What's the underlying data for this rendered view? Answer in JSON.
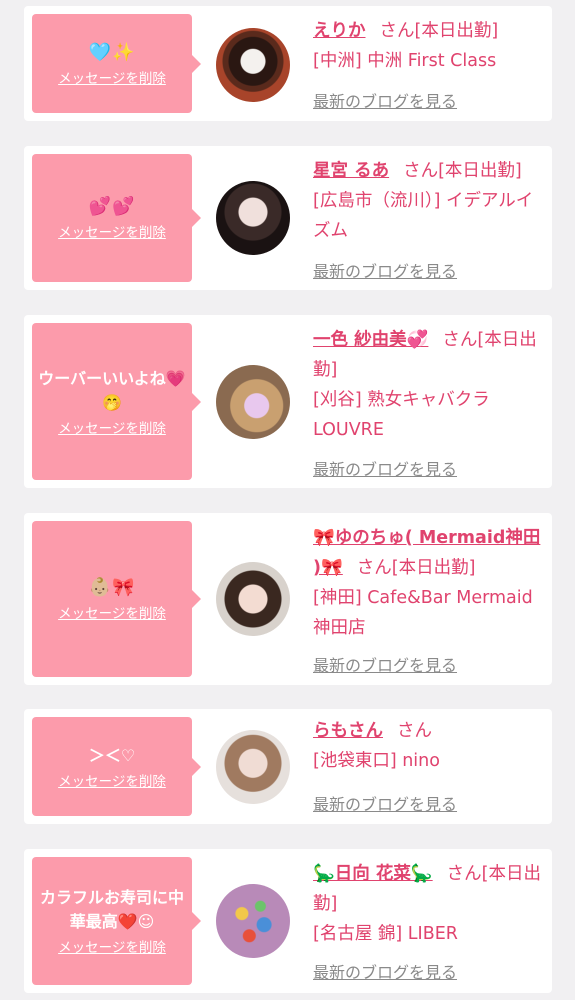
{
  "delete_label": "メッセージを削除",
  "blog_label": "最新のブログを見る",
  "san_suffix": "さん",
  "cards": [
    {
      "message": "🩵✨",
      "name": "えりか",
      "status": "[本日出勤]",
      "shop": "[中洲] 中洲 First Class"
    },
    {
      "message": "💕💕",
      "name": "星宮 るあ",
      "status": "[本日出勤]",
      "shop": "[広島市（流川）] イデアルイズム"
    },
    {
      "message": "ウーバーいいよね💗🤭",
      "name": "一色 紗由美💞",
      "status": "[本日出勤]",
      "shop": "[刈谷] 熟女キャバクラLOUVRE"
    },
    {
      "message": "👶🏼🎀",
      "name": "🎀ゆのちゅ( Mermaid神田 )🎀",
      "status": "[本日出勤]",
      "shop": "[神田] Cafe&Bar Mermaid神田店"
    },
    {
      "message": "＞＜♡",
      "name": "らもさん",
      "status": "",
      "shop": "[池袋東口] nino"
    },
    {
      "message": "カラフルお寿司に中華最高❤️☺︎",
      "name": "🦕日向 花菜🦕",
      "status": "[本日出勤]",
      "shop": "[名古屋 錦] LIBER"
    }
  ],
  "colors": {
    "accent": "#e0436e",
    "bubble": "#fc9bab",
    "background": "#f1f0f2"
  }
}
